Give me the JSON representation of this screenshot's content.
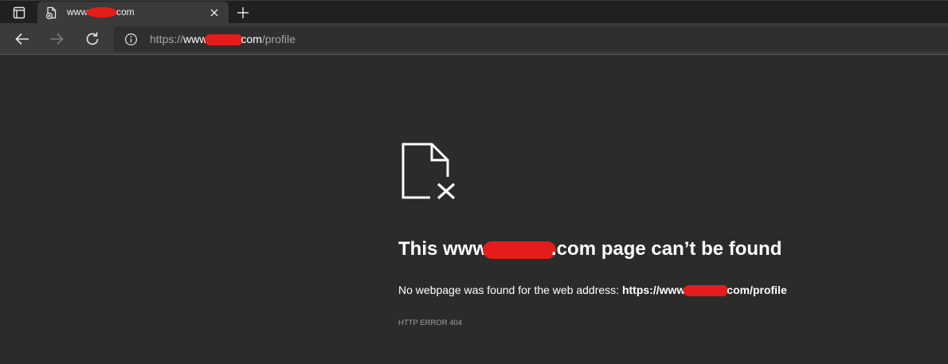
{
  "tab": {
    "title_start": "www",
    "title_end": "com",
    "close_icon": "close-icon",
    "favicon_icon": "document-error-icon"
  },
  "toolbar": {
    "back_icon": "arrow-left-icon",
    "forward_icon": "arrow-right-icon",
    "refresh_icon": "refresh-icon",
    "info_icon": "info-icon",
    "url_scheme": "https://",
    "url_host_start": "www",
    "url_host_end": "com",
    "url_path": "/profile"
  },
  "error": {
    "headline_start": "This www",
    "headline_end": ".com page can’t be found",
    "description_label": "No webpage was found for the web address: ",
    "description_url_start": "https://www",
    "description_url_end": "com/profile",
    "error_code": "HTTP ERROR 404"
  },
  "colors": {
    "background": "#2b2b2b",
    "toolbar": "#3b3b3b",
    "tabstrip": "#202020",
    "redaction": "#e51c1c"
  }
}
